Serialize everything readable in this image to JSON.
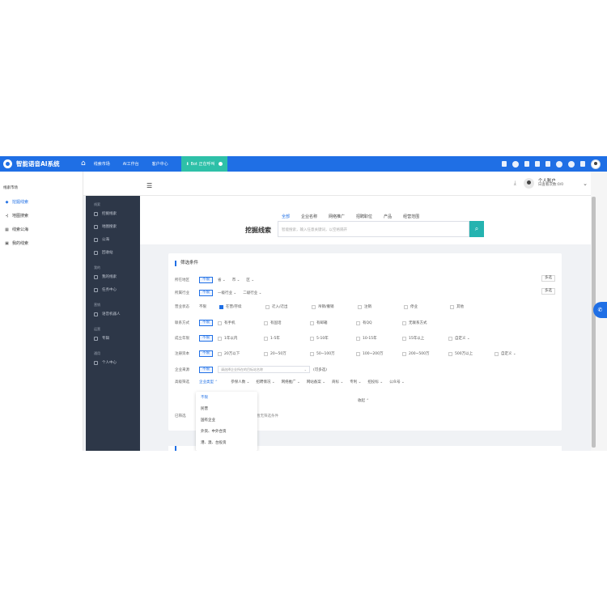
{
  "app": {
    "title": "智能语音AI系统"
  },
  "topnav": {
    "items": [
      "线索市场",
      "AI工作台",
      "客户中心"
    ],
    "live_label": "Bot 正在呼叫"
  },
  "leftbar": {
    "section": "线索市场",
    "items": [
      {
        "label": "挖掘线索",
        "icon": "diamond-icon",
        "active": true
      },
      {
        "label": "地图搜索",
        "icon": "map-icon",
        "active": false
      },
      {
        "label": "线索公海",
        "icon": "grid-icon",
        "active": false
      },
      {
        "label": "我的线索",
        "icon": "user-icon",
        "active": false
      }
    ]
  },
  "darkbar": {
    "groups": [
      {
        "title": "线索",
        "items": [
          "挖掘线索",
          "地图搜索",
          "公海",
          "回收站"
        ]
      },
      {
        "title": "我的",
        "items": [
          "我的线索",
          "任务中心"
        ]
      },
      {
        "title": "营销",
        "items": [
          "语音机器人"
        ]
      },
      {
        "title": "运营",
        "items": [
          "专辑"
        ]
      },
      {
        "title": "通用",
        "items": [
          "个人中心"
        ]
      }
    ]
  },
  "user": {
    "name": "个人账户",
    "sub": "日查看次数:0/0"
  },
  "search": {
    "title": "挖掘线索",
    "tabs": [
      "全部",
      "企业名称",
      "网络推广",
      "招聘职位",
      "产品",
      "经营范围"
    ],
    "placeholder": "智能搜索，输入任意关键词，以空格隔开"
  },
  "filters": {
    "title": "筛选条件",
    "multi_label": "多选",
    "rows": {
      "region": {
        "label": "所在地区",
        "tag": "不限",
        "dropdowns": [
          "省",
          "市",
          "区"
        ]
      },
      "industry": {
        "label": "所属行业",
        "tag": "不限",
        "dropdowns": [
          "一级行业",
          "二级行业"
        ]
      },
      "status": {
        "label": "营业状态",
        "options": [
          "不限",
          "在营/存续",
          "迁入/迁出",
          "吊销/撤销",
          "注销",
          "停业",
          "其他"
        ]
      },
      "contact": {
        "label": "联系方式",
        "tag": "不限",
        "options": [
          "有手机",
          "有固话",
          "有邮箱",
          "有QQ",
          "无联系方式"
        ]
      },
      "founded": {
        "label": "成立年限",
        "tag": "不限",
        "options": [
          "1年以内",
          "1-5年",
          "5-10年",
          "10-15年",
          "15年以上"
        ],
        "custom": "自定义"
      },
      "capital": {
        "label": "注册资本",
        "tag": "不限",
        "options": [
          "20万以下",
          "20~50万",
          "50~100万",
          "100~200万",
          "200~500万",
          "500万以上"
        ],
        "custom": "自定义"
      },
      "source": {
        "label": "企业来源",
        "tag": "不限",
        "placeholder": "请选择企业所在的目标站名称",
        "note": "(可多选)"
      },
      "advanced": {
        "label": "高级筛选",
        "items": [
          "企业类型",
          "参保人数",
          "招聘情况",
          "网络推广",
          "网站备案",
          "商标",
          "专利",
          "招投标",
          "公众号"
        ]
      }
    },
    "collapse": "收起",
    "chosen_label": "已筛选",
    "chosen_hint": "暂无筛选条件"
  },
  "dropdown": {
    "options": [
      "不限",
      "民营",
      "国有企业",
      "外资、中外合资",
      "港、澳、台投资"
    ]
  }
}
